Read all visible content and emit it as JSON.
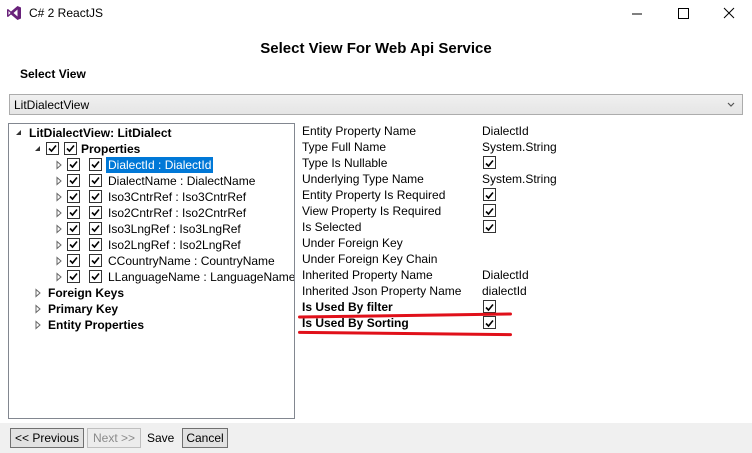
{
  "window": {
    "title": "C# 2 ReactJS"
  },
  "heading": "Select View For Web Api Service",
  "select_view_label": "Select View",
  "view_select": {
    "value": "LitDialectView"
  },
  "tree": {
    "root": "LitDialectView: LitDialect",
    "properties_label": "Properties",
    "items": [
      {
        "label": "DialectId : DialectId",
        "selected": true,
        "checked": true
      },
      {
        "label": "DialectName : DialectName",
        "checked": true
      },
      {
        "label": "Iso3CntrRef : Iso3CntrRef",
        "checked": true
      },
      {
        "label": "Iso2CntrRef : Iso2CntrRef",
        "checked": true
      },
      {
        "label": "Iso3LngRef : Iso3LngRef",
        "checked": true
      },
      {
        "label": "Iso2LngRef : Iso2LngRef",
        "checked": true
      },
      {
        "label": "CCountryName : CountryName",
        "checked": true
      },
      {
        "label": "LLanguageName : LanguageName",
        "checked": true
      }
    ],
    "groups": [
      "Foreign Keys",
      "Primary Key",
      "Entity Properties"
    ]
  },
  "details": [
    {
      "name": "Entity Property Name",
      "value": "DialectId"
    },
    {
      "name": "Type Full Name",
      "value": "System.String"
    },
    {
      "name": "Type Is Nullable",
      "checked": true
    },
    {
      "name": "Underlying Type Name",
      "value": "System.String"
    },
    {
      "name": "Entity Property Is Required",
      "checked": true
    },
    {
      "name": "View Property Is Required",
      "checked": true
    },
    {
      "name": "Is Selected",
      "checked": true
    },
    {
      "name": "Under Foreign Key"
    },
    {
      "name": "Under Foreign Key Chain"
    },
    {
      "name": "Inherited Property Name",
      "value": "DialectId"
    },
    {
      "name": "Inherited Json Property Name",
      "value": "dialectId"
    },
    {
      "name": "Is Used By filter",
      "checked": true,
      "bold": true
    },
    {
      "name": "Is Used By Sorting",
      "checked": true,
      "bold": true
    }
  ],
  "buttons": {
    "previous": "<< Previous",
    "next": "Next >>",
    "save": "Save",
    "cancel": "Cancel"
  },
  "colors": {
    "selection": "#0078d7",
    "annotation": "#e0101a",
    "vs_purple": "#68217a"
  }
}
